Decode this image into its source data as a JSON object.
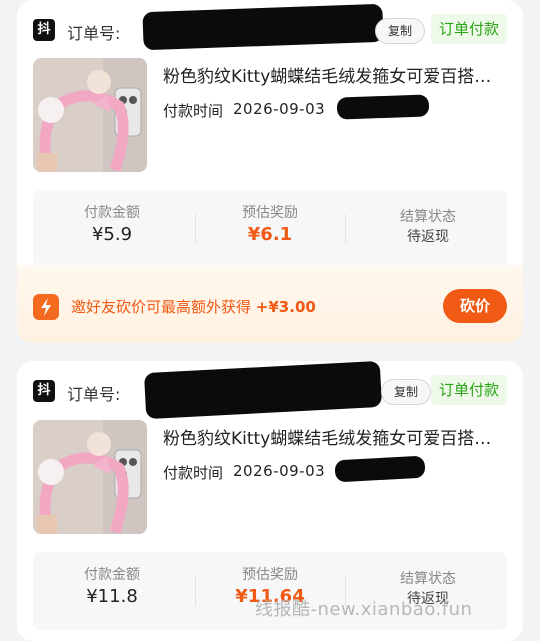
{
  "orders": [
    {
      "platform_badge": "抖",
      "order_no_label": "订单号:",
      "copy_label": "复制",
      "status": "订单付款",
      "title": "粉色豹纹Kitty蝴蝶结毛绒发箍女可爱百搭…",
      "pay_time_label": "付款时间",
      "pay_time_value": "2026-09-03",
      "stats": [
        {
          "label": "付款金额",
          "value": "¥5.9"
        },
        {
          "label": "预估奖励",
          "value": "¥6.1"
        },
        {
          "label": "结算状态",
          "value": "待返现"
        }
      ],
      "bargain": {
        "text": "邀好友砍价可最高额外获得",
        "amount": "+¥3.00",
        "button": "砍价"
      }
    },
    {
      "platform_badge": "抖",
      "order_no_label": "订单号:",
      "copy_label": "复制",
      "status": "订单付款",
      "title": "粉色豹纹Kitty蝴蝶结毛绒发箍女可爱百搭…",
      "pay_time_label": "付款时间",
      "pay_time_value": "2026-09-03",
      "stats": [
        {
          "label": "付款金额",
          "value": "¥11.8"
        },
        {
          "label": "预估奖励",
          "value": "¥11.64"
        },
        {
          "label": "结算状态",
          "value": "待返现"
        }
      ]
    }
  ],
  "watermark": "线报酷-new.xianbao.fun",
  "colors": {
    "accent": "#f05a14",
    "status_green": "#2aa515",
    "badge_black": "#111111"
  },
  "icons": {
    "platform": "douyin-badge-icon",
    "bargain": "lightning-bolt-icon"
  }
}
